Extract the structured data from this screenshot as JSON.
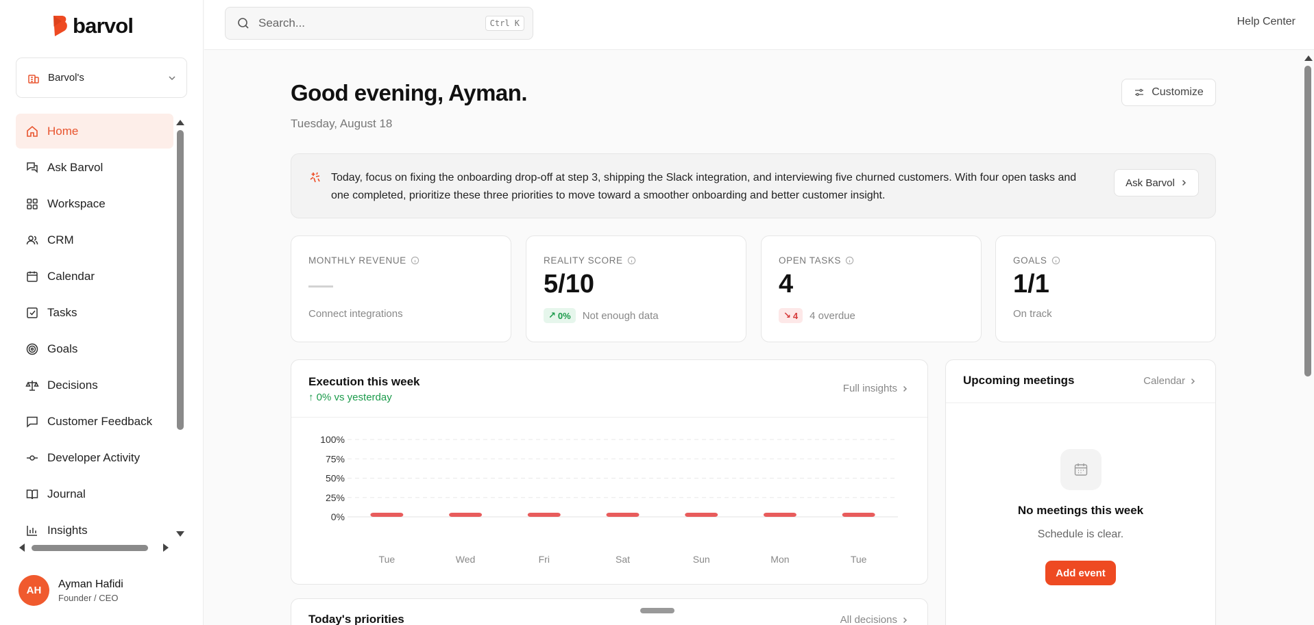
{
  "brand": {
    "name": "barvol",
    "accent": "#ee4a22"
  },
  "workspace": {
    "name": "Barvol's"
  },
  "sidebar": {
    "items": [
      {
        "label": "Home",
        "icon": "home-icon",
        "active": true
      },
      {
        "label": "Ask Barvol",
        "icon": "chat-icon"
      },
      {
        "label": "Workspace",
        "icon": "grid-icon"
      },
      {
        "label": "CRM",
        "icon": "users-icon"
      },
      {
        "label": "Calendar",
        "icon": "calendar-icon"
      },
      {
        "label": "Tasks",
        "icon": "checkbox-icon"
      },
      {
        "label": "Goals",
        "icon": "target-icon"
      },
      {
        "label": "Decisions",
        "icon": "scale-icon"
      },
      {
        "label": "Customer Feedback",
        "icon": "message-icon"
      },
      {
        "label": "Developer Activity",
        "icon": "commit-icon"
      },
      {
        "label": "Journal",
        "icon": "book-icon"
      },
      {
        "label": "Insights",
        "icon": "bar-chart-icon"
      }
    ]
  },
  "user": {
    "initials": "AH",
    "name": "Ayman Hafidi",
    "role": "Founder / CEO"
  },
  "topbar": {
    "search_placeholder": "Search...",
    "shortcut": "Ctrl K",
    "help": "Help Center"
  },
  "main": {
    "greeting": "Good evening, Ayman.",
    "date": "Tuesday, August 18",
    "customize": "Customize",
    "brief": {
      "text": "Today, focus on fixing the onboarding drop-off at step 3, shipping the Slack integration, and interviewing five churned customers. With four open tasks and one completed, prioritize these three priorities to move toward a smoother onboarding and better customer insight.",
      "button": "Ask Barvol"
    },
    "stats": [
      {
        "label": "MONTHLY REVENUE",
        "value": "",
        "sub": "Connect integrations"
      },
      {
        "label": "REALITY SCORE",
        "value": "5/10",
        "pill": "0%",
        "sub": "Not enough data"
      },
      {
        "label": "OPEN TASKS",
        "value": "4",
        "pill": "4",
        "sub": "4 overdue"
      },
      {
        "label": "GOALS",
        "value": "1/1",
        "sub": "On track"
      }
    ],
    "execution": {
      "title": "Execution this week",
      "delta": "0% vs yesterday",
      "link": "Full insights"
    },
    "meetings": {
      "title": "Upcoming meetings",
      "link": "Calendar",
      "empty_title": "No meetings this week",
      "empty_sub": "Schedule is clear.",
      "button": "Add event"
    },
    "priorities": {
      "title": "Today's priorities",
      "link": "All decisions"
    }
  },
  "chart_data": {
    "type": "bar",
    "categories": [
      "Tue",
      "Wed",
      "Fri",
      "Sat",
      "Sun",
      "Mon",
      "Tue"
    ],
    "values": [
      0,
      0,
      0,
      0,
      0,
      0,
      0
    ],
    "y_ticks": [
      "100%",
      "75%",
      "50%",
      "25%",
      "0%"
    ],
    "ylim": [
      0,
      100
    ],
    "grid": true,
    "bar_color": "#e85c5c"
  }
}
